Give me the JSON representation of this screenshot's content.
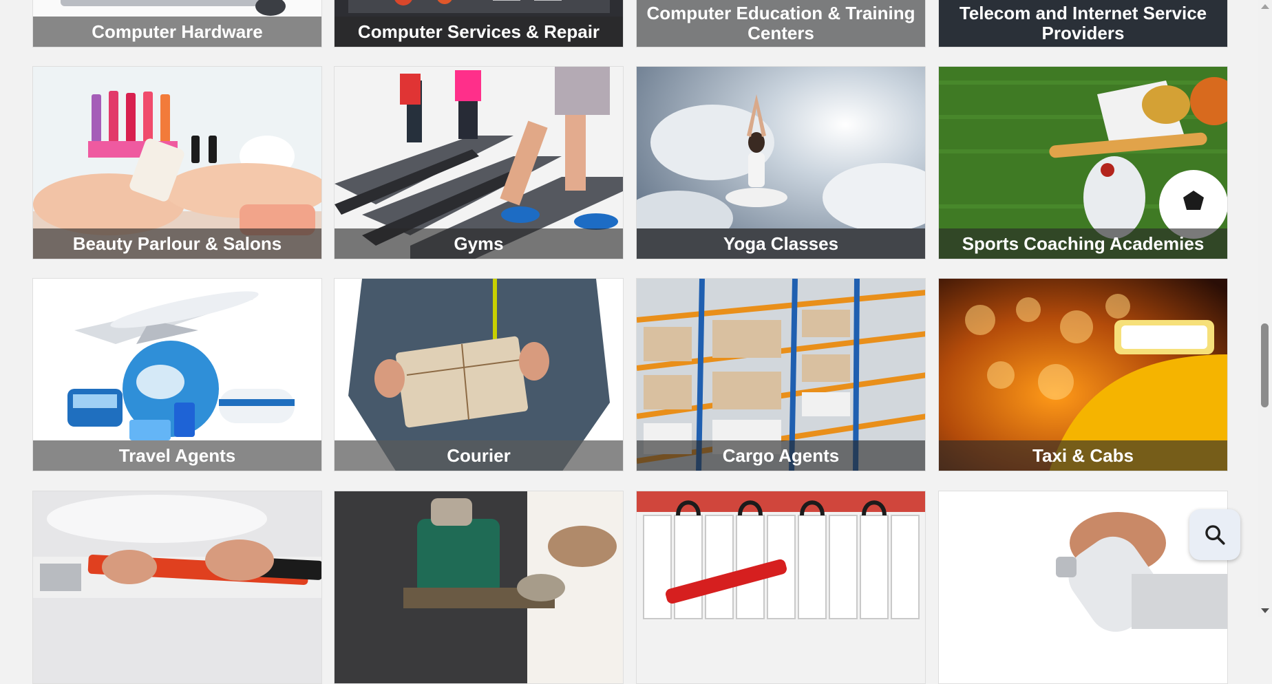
{
  "categories": [
    {
      "label": "Computer Hardware"
    },
    {
      "label": "Computer Services & Repair"
    },
    {
      "label": "Computer Education & Training Centers"
    },
    {
      "label": "Telecom and Internet Service Providers"
    },
    {
      "label": "Beauty Parlour & Salons"
    },
    {
      "label": "Gyms"
    },
    {
      "label": "Yoga Classes"
    },
    {
      "label": "Sports Coaching Academies"
    },
    {
      "label": "Travel Agents"
    },
    {
      "label": "Courier"
    },
    {
      "label": "Cargo Agents"
    },
    {
      "label": "Taxi & Cabs"
    },
    {
      "label": ""
    },
    {
      "label": ""
    },
    {
      "label": ""
    },
    {
      "label": ""
    }
  ],
  "search_fab": {
    "icon": "search-icon"
  },
  "colors": {
    "page_bg": "#f2f2f2",
    "caption_overlay": "rgba(40,40,40,0.62)",
    "fab_bg": "#e9eef6"
  }
}
